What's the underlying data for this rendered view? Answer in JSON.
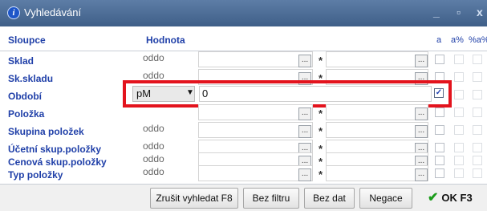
{
  "window": {
    "title": "Vyhledávání",
    "minimize_label": "_",
    "restore_label": "▫",
    "close_label": "x"
  },
  "header": {
    "col_sloupce": "Sloupce",
    "col_hodnota": "Hodnota",
    "col_a": "a",
    "col_ap": "a%",
    "col_pap": "%a%"
  },
  "rows": [
    {
      "label": "Sklad",
      "operator": "oddo"
    },
    {
      "label": "Sk.skladu",
      "operator": "oddo"
    },
    {
      "label": "Období",
      "operator": ""
    },
    {
      "label": "Položka",
      "operator": "oddo"
    },
    {
      "label": "Skupina položek",
      "operator": "oddo"
    },
    {
      "label": "Účetní skup.položky",
      "operator": "oddo"
    },
    {
      "label": "Cenová skup.položky",
      "operator": "oddo"
    },
    {
      "label": "Typ položky",
      "operator": "oddo"
    }
  ],
  "selected_row": {
    "operator": "pM",
    "value": "0",
    "checked": true
  },
  "star": "*",
  "dots": "...",
  "footer": {
    "cancel_search": "Zrušit vyhledat F8",
    "no_filter": "Bez filtru",
    "no_data": "Bez dat",
    "negace": "Negace",
    "ok": "OK F3"
  },
  "colors": {
    "label": "#1f3fa8",
    "highlight": "#e3131d",
    "ok_check": "#1a9c1a"
  }
}
